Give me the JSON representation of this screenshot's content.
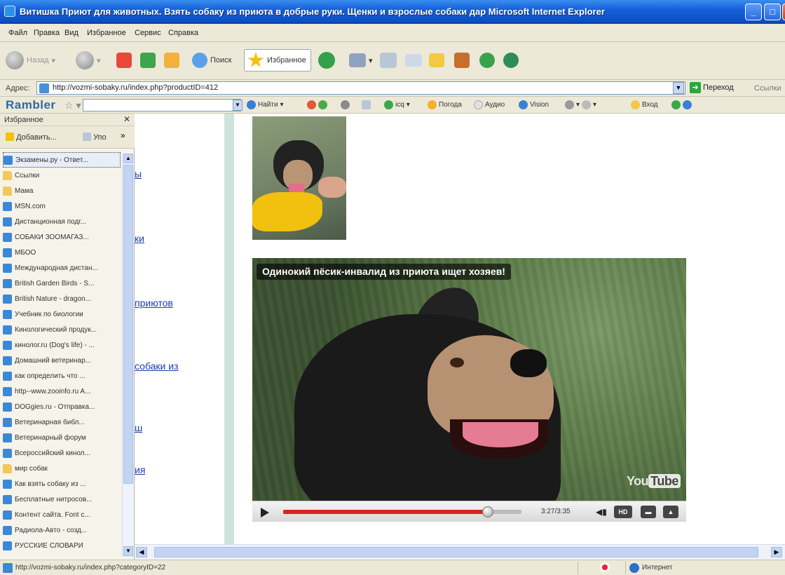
{
  "window": {
    "title": "Витишка  Приют для животных. Взять собаку из приюта в добрые руки. Щенки и взрослые собаки дар  Microsoft Internet Explorer"
  },
  "menu": [
    "Файл",
    "Правка",
    "Вид",
    "Избранное",
    "Сервис",
    "Справка"
  ],
  "toolbar": {
    "back": "Назад",
    "search": "Поиск",
    "favorites": "Избранное"
  },
  "address": {
    "label": "Адрес:",
    "url": "http://vozmi-sobaky.ru/index.php?productID=412",
    "go": "Переход",
    "links": "Ссылки"
  },
  "rambler": {
    "logo": "Rambler",
    "find": "Найти",
    "icq": "icq",
    "weather": "Погода",
    "audio": "Аудио",
    "vision": "Vision",
    "login": "Вход"
  },
  "favorites": {
    "title": "Избранное",
    "add": "Добавить...",
    "organize": "Упо",
    "items": [
      {
        "label": "Экзамены.ру - Ответ...",
        "type": "page",
        "selected": true
      },
      {
        "label": "Ссылки",
        "type": "folder"
      },
      {
        "label": "Мама",
        "type": "folder"
      },
      {
        "label": "MSN.com",
        "type": "page"
      },
      {
        "label": "Дистанционная подг...",
        "type": "page"
      },
      {
        "label": "СОБАКИ ЗООМАГАЗ...",
        "type": "page"
      },
      {
        "label": "МБОО",
        "type": "page"
      },
      {
        "label": "Международная дистан...",
        "type": "page"
      },
      {
        "label": "British Garden Birds - S...",
        "type": "page"
      },
      {
        "label": "British Nature - dragon...",
        "type": "page"
      },
      {
        "label": "Учебник по биологии",
        "type": "page"
      },
      {
        "label": "Кинологический продук...",
        "type": "page"
      },
      {
        "label": "кинолог.ru (Dog's life) - ...",
        "type": "page"
      },
      {
        "label": "Домашний ветеринар...",
        "type": "page"
      },
      {
        "label": "как определить что ...",
        "type": "page"
      },
      {
        "label": "http--www.zooinfo.ru A...",
        "type": "page"
      },
      {
        "label": "DOGgies.ru - Отправка...",
        "type": "page"
      },
      {
        "label": "Ветеринарная библ...",
        "type": "page"
      },
      {
        "label": "Ветеринарный форум",
        "type": "page"
      },
      {
        "label": "Всероссийский кинол...",
        "type": "page"
      },
      {
        "label": "мир собак",
        "type": "folder"
      },
      {
        "label": "Как взять собаку из ...",
        "type": "page"
      },
      {
        "label": "Бесплатные нитросов...",
        "type": "page"
      },
      {
        "label": "Контент сайта. Font c...",
        "type": "page"
      },
      {
        "label": "Радиола-Авто - созд...",
        "type": "page"
      },
      {
        "label": "РУССКИЕ СЛОВАРИ",
        "type": "page"
      }
    ]
  },
  "page": {
    "stub_links": [
      "ы",
      "ки",
      "приютов",
      "собаки из",
      "ш",
      "ия"
    ],
    "video": {
      "title": "Одинокий пёсик-инвалид из приюта ищет хозяев!",
      "time": "3:27/3:35",
      "progress": 0.86,
      "hd": "HD",
      "logo_you": "You",
      "logo_tube": "Tube"
    }
  },
  "status": {
    "url": "http://vozmi-sobaky.ru/index.php?categoryID=22",
    "zone": "Интернет"
  },
  "colors": {
    "titlebar": "#0d4fc4",
    "progress": "#d92323",
    "link": "#1a3ea8"
  }
}
